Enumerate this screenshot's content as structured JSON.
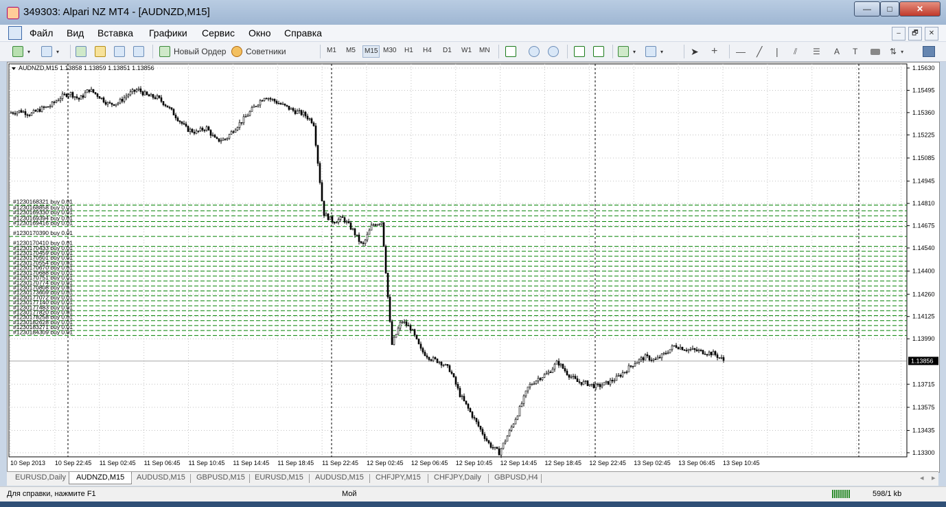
{
  "window": {
    "title": "349303: Alpari NZ MT4 - [AUDNZD,M15]",
    "controls": {
      "minimize": "—",
      "maximize": "□",
      "close": "✕"
    }
  },
  "menu": {
    "items": [
      "Файл",
      "Вид",
      "Вставка",
      "Графики",
      "Сервис",
      "Окно",
      "Справка"
    ],
    "mdi_controls": {
      "minimize": "–",
      "restore": "🗗",
      "close": "✕"
    }
  },
  "toolbar": {
    "new_order": "Новый Ордер",
    "advisors": "Советники",
    "timeframes": [
      "M1",
      "M5",
      "M15",
      "M30",
      "H1",
      "H4",
      "D1",
      "W1",
      "MN"
    ],
    "active_timeframe": "M15",
    "text_tool": "A"
  },
  "chart": {
    "header": "AUDNZD,M15  1.13858 1.13859 1.13851 1.13856",
    "current_price_label": "1.13856",
    "colors": {
      "background": "#ffffff",
      "grid": "#c0c0c0",
      "candles": "#000000",
      "order_lines": "#008000",
      "price_tag": "#000000"
    },
    "price_axis": [
      "1.15630",
      "1.15495",
      "1.15360",
      "1.15225",
      "1.15085",
      "1.14945",
      "1.14810",
      "1.14675",
      "1.14540",
      "1.14400",
      "1.14260",
      "1.14125",
      "1.13990",
      "1.13856",
      "1.13715",
      "1.13575",
      "1.13435",
      "1.13300"
    ],
    "time_axis": [
      "10 Sep 2013",
      "10 Sep 22:45",
      "11 Sep 02:45",
      "11 Sep 06:45",
      "11 Sep 10:45",
      "11 Sep 14:45",
      "11 Sep 18:45",
      "11 Sep 22:45",
      "12 Sep 02:45",
      "12 Sep 06:45",
      "12 Sep 10:45",
      "12 Sep 14:45",
      "12 Sep 18:45",
      "12 Sep 22:45",
      "13 Sep 02:45",
      "13 Sep 06:45",
      "13 Sep 10:45"
    ],
    "order_labels": [
      "#1230168321 buy 0.01",
      "#1230168858 buy 0.01",
      "#1230169330 buy 0.01",
      "#1230169394 buy 0.01",
      "#1230169416 buy 0.01",
      "#1230170390 buy 0.01",
      "#1230170410 buy 0.01",
      "#1230170433 buy 0.01",
      "#1230170459 buy 0.01",
      "#1230170501 buy 0.01",
      "#1230170554 buy 0.01",
      "#1230170670 buy 0.01",
      "#1230170688 buy 0.01",
      "#1230170751 buy 0.01",
      "#1230170774 buy 0.01",
      "#1230170808 buy 0.01",
      "#1230173609 buy 0.01",
      "#1230177072 buy 0.01",
      "#1230177140 buy 0.01",
      "#1230177483 buy 0.01",
      "#1230177820 buy 0.01",
      "#1230178258 buy 0.01",
      "#1230182628 buy 0.01",
      "#1230183271 buy 0.01",
      "#1230184309 buy 0.01"
    ],
    "order_prices": [
      1.148,
      1.14765,
      1.14735,
      1.147,
      1.1467,
      1.1461,
      1.1455,
      1.1452,
      1.1449,
      1.1446,
      1.1443,
      1.144,
      1.1437,
      1.1434,
      1.1431,
      1.1428,
      1.1425,
      1.1422,
      1.1419,
      1.1416,
      1.1413,
      1.141,
      1.1407,
      1.1404,
      1.1401
    ],
    "price_series": [
      1.1536,
      1.1537,
      1.1535,
      1.1538,
      1.154,
      1.1545,
      1.1548,
      1.1544,
      1.155,
      1.1546,
      1.1541,
      1.1542,
      1.1547,
      1.155,
      1.1546,
      1.1545,
      1.154,
      1.1533,
      1.1526,
      1.1524,
      1.1527,
      1.1519,
      1.152,
      1.1527,
      1.1533,
      1.154,
      1.1546,
      1.1543,
      1.154,
      1.1537,
      1.1535,
      1.153,
      1.1475,
      1.147,
      1.1472,
      1.1465,
      1.1455,
      1.1468,
      1.147,
      1.1395,
      1.141,
      1.1405,
      1.1392,
      1.1387,
      1.1385,
      1.138,
      1.1365,
      1.1355,
      1.1345,
      1.1335,
      1.133,
      1.1342,
      1.1355,
      1.137,
      1.1375,
      1.1378,
      1.1385,
      1.1378,
      1.1373,
      1.1372,
      1.137,
      1.1372,
      1.1375,
      1.138,
      1.1385,
      1.1388,
      1.1386,
      1.139,
      1.1395,
      1.1393,
      1.1392,
      1.1391,
      1.139,
      1.1386
    ]
  },
  "tabs": [
    "EURUSD,Daily",
    "AUDNZD,M15",
    "AUDUSD,M15",
    "GBPUSD,M15",
    "EURUSD,M15",
    "AUDUSD,M15",
    "CHFJPY,M15",
    "CHFJPY,Daily",
    "GBPUSD,H4"
  ],
  "active_tab": "AUDNZD,M15",
  "tab_scroll": {
    "left": "◂",
    "right": "▸"
  },
  "status": {
    "help": "Для справки, нажмите F1",
    "profile": "Мой",
    "traffic": "598/1 kb"
  }
}
